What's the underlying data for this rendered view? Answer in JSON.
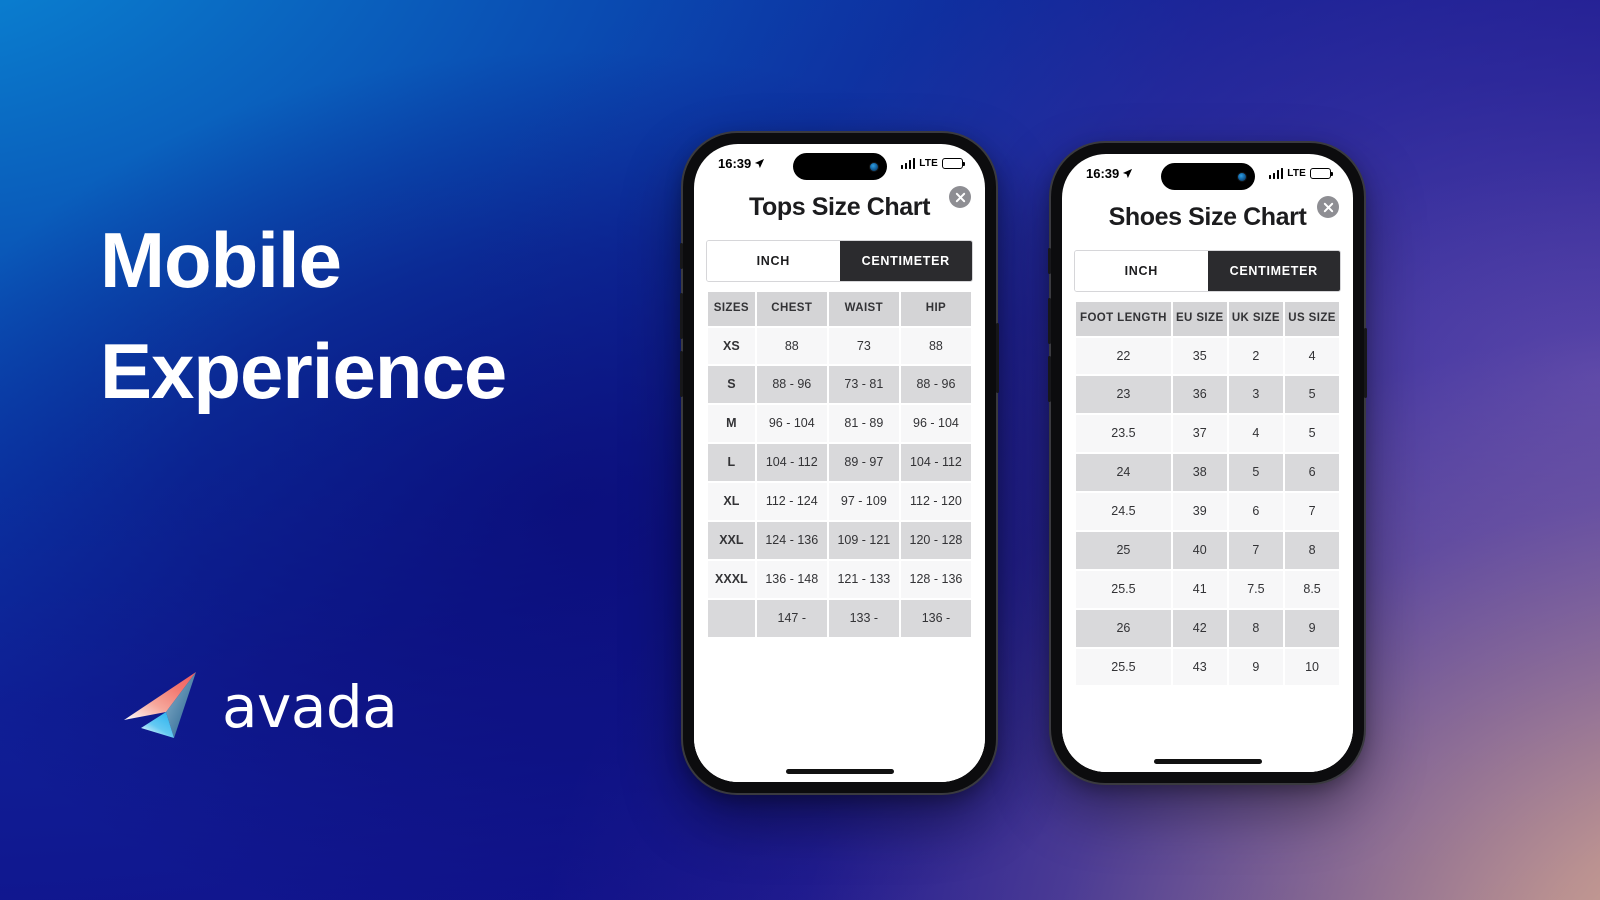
{
  "background": {
    "accent_blue": "#0a8ad8",
    "deep_navy": "#11108c",
    "purple": "#6c5aa8",
    "peach": "#d9a889"
  },
  "hero": {
    "headline_line1": "Mobile",
    "headline_line2": "Experience",
    "logo_text": "avada"
  },
  "phones": [
    {
      "id": "tops",
      "status": {
        "time": "16:39",
        "carrier": "LTE"
      },
      "title": "Tops Size Chart",
      "units": [
        {
          "label": "INCH",
          "active": false
        },
        {
          "label": "CENTIMETER",
          "active": true
        }
      ],
      "table": {
        "headers": [
          "SIZES",
          "CHEST",
          "WAIST",
          "HIP"
        ],
        "rows": [
          [
            "XS",
            "88",
            "73",
            "88"
          ],
          [
            "S",
            "88 - 96",
            "73 - 81",
            "88 - 96"
          ],
          [
            "M",
            "96 - 104",
            "81 - 89",
            "96 - 104"
          ],
          [
            "L",
            "104 - 112",
            "89 - 97",
            "104 - 112"
          ],
          [
            "XL",
            "112 - 124",
            "97 - 109",
            "112 - 120"
          ],
          [
            "XXL",
            "124 - 136",
            "109 - 121",
            "120 - 128"
          ],
          [
            "XXXL",
            "136 - 148",
            "121 - 133",
            "128 - 136"
          ],
          [
            "",
            "147 -",
            "133 -",
            "136 -"
          ]
        ]
      }
    },
    {
      "id": "shoes",
      "status": {
        "time": "16:39",
        "carrier": "LTE"
      },
      "title": "Shoes Size Chart",
      "units": [
        {
          "label": "INCH",
          "active": false
        },
        {
          "label": "CENTIMETER",
          "active": true
        }
      ],
      "table": {
        "headers": [
          "FOOT LENGTH",
          "EU SIZE",
          "UK SIZE",
          "US SIZE"
        ],
        "rows": [
          [
            "22",
            "35",
            "2",
            "4"
          ],
          [
            "23",
            "36",
            "3",
            "5"
          ],
          [
            "23.5",
            "37",
            "4",
            "5"
          ],
          [
            "24",
            "38",
            "5",
            "6"
          ],
          [
            "24.5",
            "39",
            "6",
            "7"
          ],
          [
            "25",
            "40",
            "7",
            "8"
          ],
          [
            "25.5",
            "41",
            "7.5",
            "8.5"
          ],
          [
            "26",
            "42",
            "8",
            "9"
          ],
          [
            "25.5",
            "43",
            "9",
            "10"
          ]
        ]
      }
    }
  ]
}
